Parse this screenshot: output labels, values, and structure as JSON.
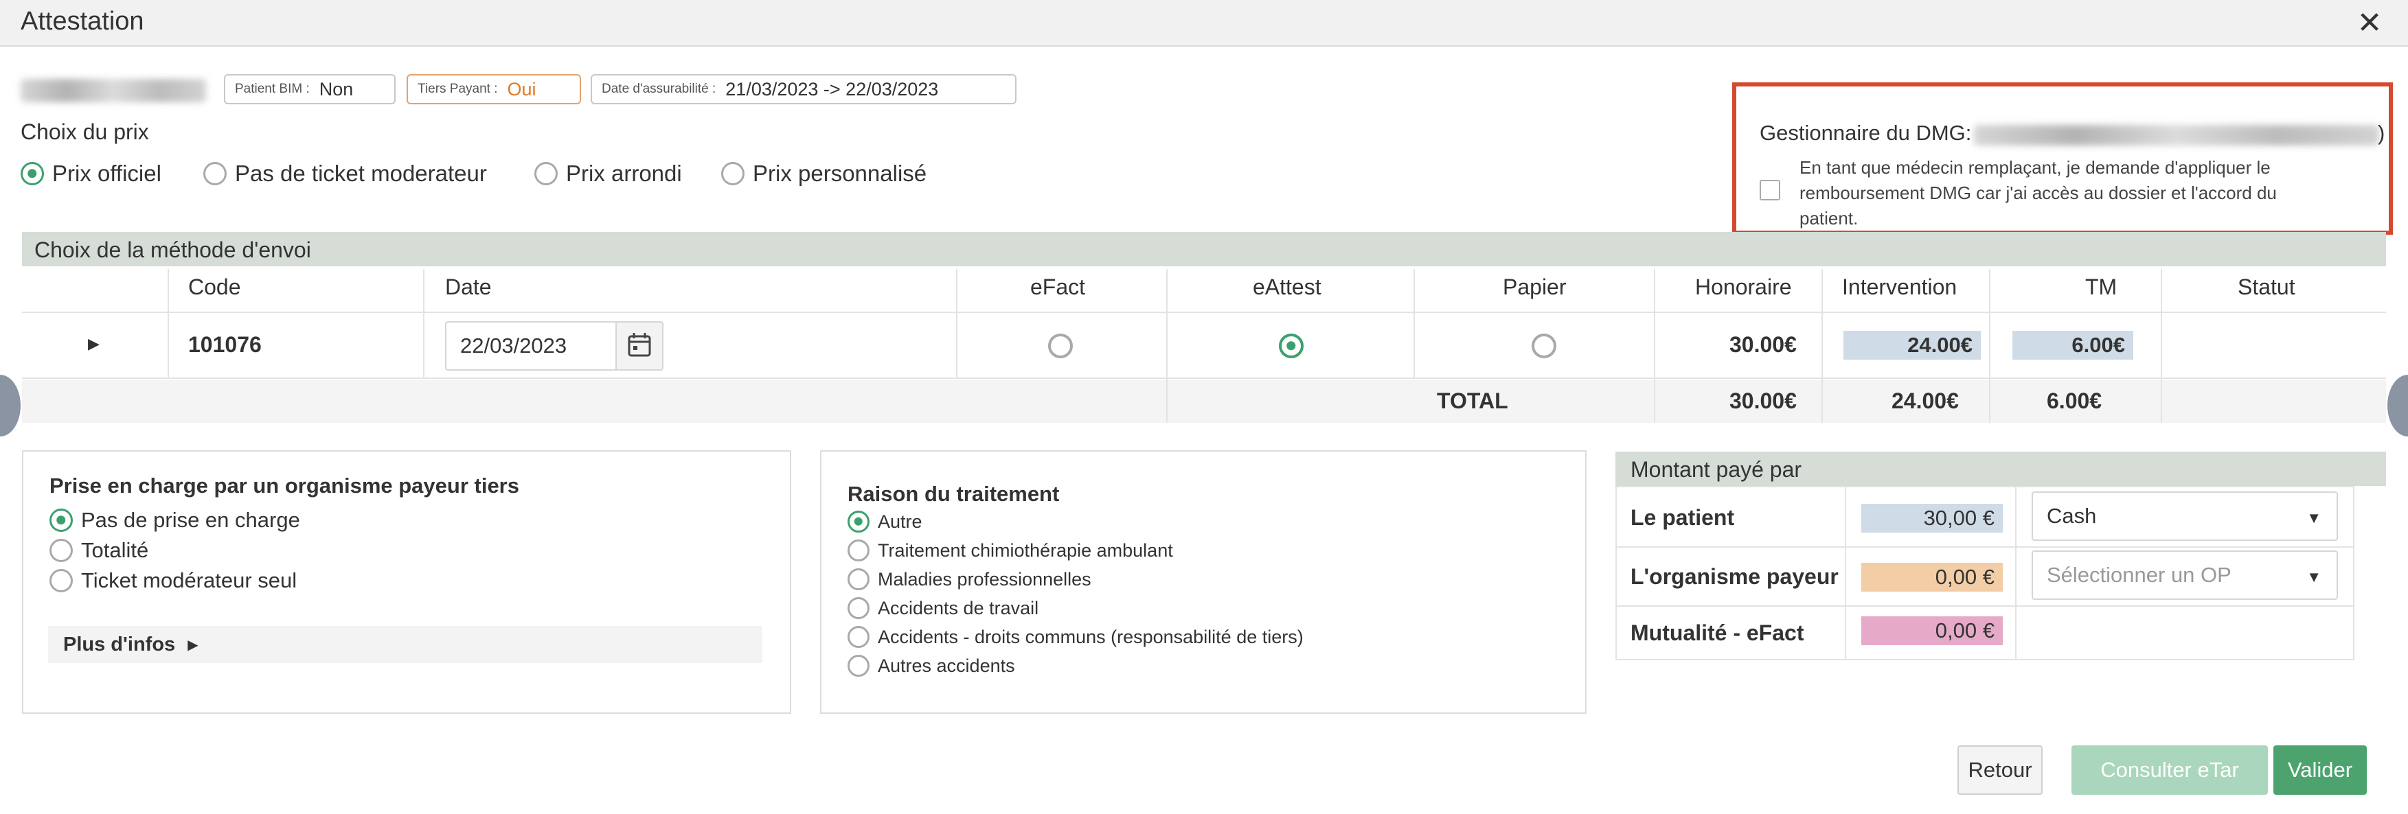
{
  "window": {
    "title": "Attestation"
  },
  "patient": {
    "bim_label": "Patient BIM :",
    "bim_value": "Non",
    "tiers_label": "Tiers Payant :",
    "tiers_value": "Oui",
    "assur_label": "Date d'assurabilité :",
    "assur_value": "21/03/2023 -> 22/03/2023"
  },
  "price": {
    "title": "Choix du prix",
    "options": [
      "Prix officiel",
      "Pas de ticket moderateur",
      "Prix arrondi",
      "Prix personnalisé"
    ],
    "selected": "Prix officiel"
  },
  "dmg": {
    "label": "Gestionnaire du DMG:",
    "closing": ")",
    "checkbox_text": "En tant que médecin remplaçant, je demande d'appliquer le remboursement DMG car j'ai accès au dossier et l'accord du patient."
  },
  "envoi": {
    "title": "Choix de la méthode d'envoi",
    "columns": [
      "Code",
      "Date",
      "eFact",
      "eAttest",
      "Papier",
      "Honoraire",
      "Intervention",
      "TM",
      "Statut"
    ],
    "row": {
      "code": "101076",
      "date": "22/03/2023",
      "selected_method": "eAttest",
      "honoraire": "30.00€",
      "intervention": "24.00€",
      "tm": "6.00€"
    },
    "total": {
      "label": "TOTAL",
      "honoraire": "30.00€",
      "intervention": "24.00€",
      "tm": "6.00€"
    }
  },
  "prise": {
    "title": "Prise en charge par un organisme payeur tiers",
    "options": [
      "Pas de prise en charge",
      "Totalité",
      "Ticket modérateur seul"
    ],
    "selected": "Pas de prise en charge",
    "more": "Plus d'infos"
  },
  "raison": {
    "title": "Raison du traitement",
    "options": [
      "Autre",
      "Traitement chimiothérapie ambulant",
      "Maladies professionnelles",
      "Accidents de travail",
      "Accidents - droits communs (responsabilité de tiers)",
      "Autres accidents"
    ],
    "selected": "Autre"
  },
  "montant": {
    "title": "Montant payé par",
    "rows": [
      {
        "label": "Le patient",
        "amount": "30,00 €",
        "color": "#cfdbe6",
        "select": "Cash"
      },
      {
        "label": "L'organisme payeur",
        "amount": "0,00 €",
        "color": "#f2cda5",
        "select_placeholder": "Sélectionner un OP"
      },
      {
        "label": "Mutualité - eFact",
        "amount": "0,00 €",
        "color": "#e6aac8"
      }
    ]
  },
  "buttons": {
    "retour": "Retour",
    "consulter": "Consulter eTar",
    "valider": "Valider"
  },
  "colors": {
    "accent_green": "#3aa16e",
    "section_header": "#d5ddd6",
    "highlight_red": "#d44a2f",
    "amount_blue": "#cfdbe6"
  }
}
